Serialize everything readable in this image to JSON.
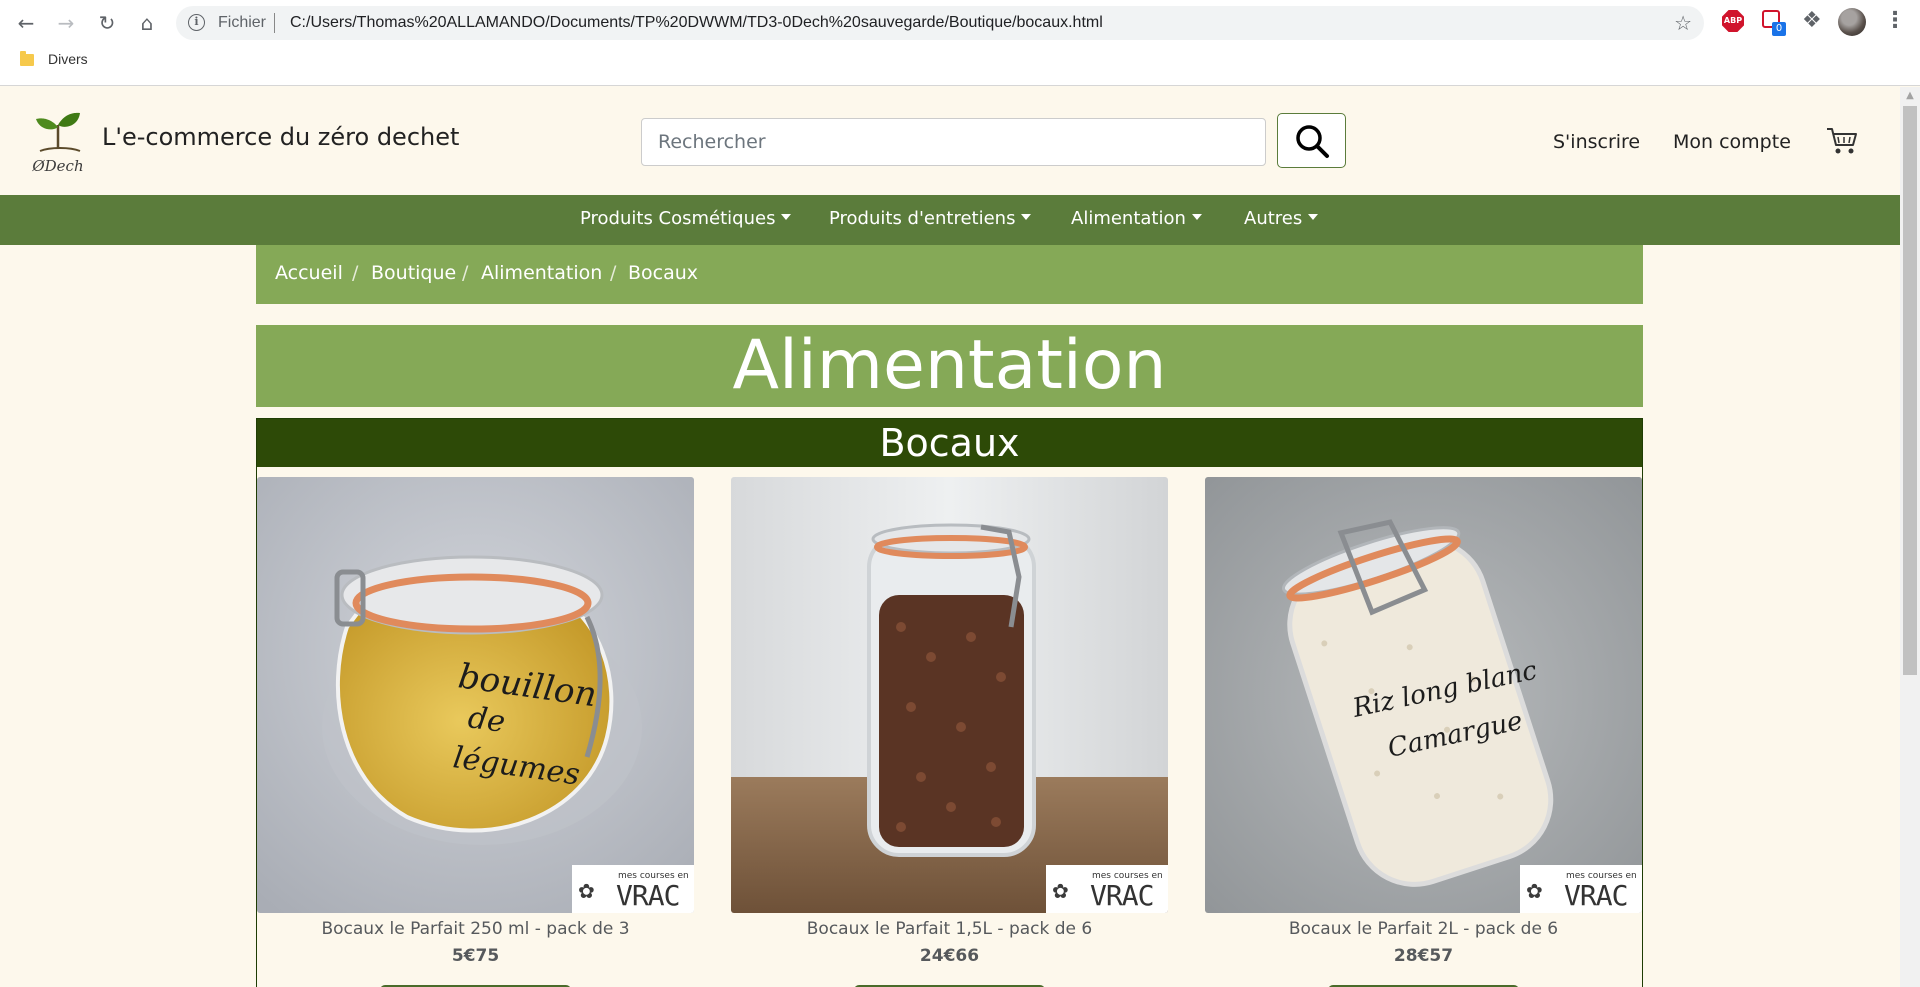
{
  "browser": {
    "scheme": "Fichier",
    "url": "C:/Users/Thomas%20ALLAMANDO/Documents/TP%20DWWM/TD3-0Dech%20sauvegarde/Boutique/bocaux.html",
    "bookmark": "Divers",
    "ext_abp_label": "ABP",
    "ext_badge": "0"
  },
  "header": {
    "logo_text": "ØDech",
    "site_title": "L'e-commerce du zéro dechet",
    "search_placeholder": "Rechercher",
    "links": [
      "S'inscrire",
      "Mon compte"
    ]
  },
  "nav": {
    "items": [
      "Produits Cosmétiques",
      "Produits d'entretiens",
      "Alimentation",
      "Autres"
    ]
  },
  "breadcrumb": [
    "Accueil",
    "Boutique",
    "Alimentation",
    "Bocaux"
  ],
  "breadcrumb_sep": "/",
  "page": {
    "title": "Alimentation",
    "section": "Bocaux"
  },
  "products": [
    {
      "name": "Bocaux le Parfait 250 ml - pack de 3",
      "price": "5€75",
      "jar_text": "bouillon de légumes"
    },
    {
      "name": "Bocaux le Parfait 1,5L - pack de 6",
      "price": "24€66"
    },
    {
      "name": "Bocaux le Parfait 2L - pack de 6",
      "price": "28€57",
      "jar_text": "Riz long blanc Camargue"
    }
  ],
  "vrac_badge": {
    "small": "mes courses en",
    "big": "VRAC"
  },
  "colors": {
    "nav_green": "#5b7c3b",
    "light_green": "#85a957",
    "dark_green": "#2d4a07",
    "page_bg": "#fdf8ec"
  }
}
